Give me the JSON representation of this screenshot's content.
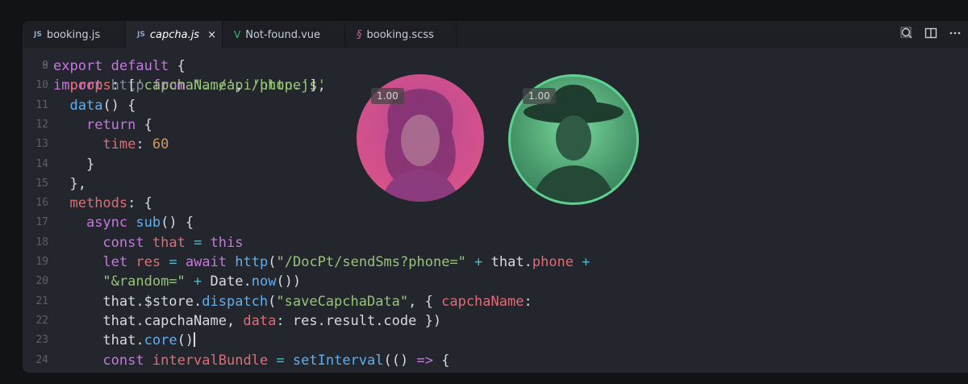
{
  "tabs": [
    {
      "lang": "JS",
      "label": "booking.js",
      "active": false
    },
    {
      "lang": "JS",
      "label": "capcha.js",
      "active": true,
      "close": "×"
    },
    {
      "lang": "V",
      "label": "Not-found.vue",
      "active": false
    },
    {
      "lang": "§",
      "label": "booking.scss",
      "active": false
    }
  ],
  "code_lines": [
    {
      "n": "9",
      "html": "<span class='kw'>export default</span> <span class='plain'>{</span>"
    },
    {
      "n": "10",
      "html": "  <span class='prop'>props</span><span class='plain'>: [</span><span class='str'>'capchaName'</span><span class='plain'>, </span><span class='str'>'phone'</span><span class='plain'>],</span>"
    },
    {
      "n": "11",
      "html": "  <span class='fn'>data</span><span class='plain'>() {</span>"
    },
    {
      "n": "12",
      "html": "    <span class='kw'>return</span> <span class='plain'>{</span>"
    },
    {
      "n": "13",
      "html": "      <span class='prop'>time</span><span class='plain'>: </span><span class='num'>60</span>"
    },
    {
      "n": "14",
      "html": "    <span class='plain'>}</span>"
    },
    {
      "n": "15",
      "html": "  <span class='plain'>},</span>"
    },
    {
      "n": "16",
      "html": "  <span class='prop'>methods</span><span class='plain'>: {</span>"
    },
    {
      "n": "17",
      "html": "    <span class='kw'>async</span> <span class='fn'>sub</span><span class='plain'>() {</span>"
    },
    {
      "n": "18",
      "html": "      <span class='kw'>const</span> <span class='prop'>that</span> <span class='op'>=</span> <span class='kw'>this</span>"
    },
    {
      "n": "19",
      "html": "      <span class='kw'>let</span> <span class='prop'>res</span> <span class='op'>=</span> <span class='kw'>await</span> <span class='fn'>http</span><span class='plain'>(</span><span class='str'>\"/DocPt/sendSms?phone=\"</span> <span class='op'>+</span> <span class='plain'>that.</span><span class='prop'>phone</span> <span class='op'>+</span>"
    },
    {
      "n": "20",
      "html": "      <span class='str'>\"&amp;random=\"</span> <span class='op'>+</span> <span class='plain'>Date.</span><span class='fn'>now</span><span class='plain'>())</span>"
    },
    {
      "n": "21",
      "html": "      <span class='plain'>that.$store.</span><span class='fn'>dispatch</span><span class='plain'>(</span><span class='str'>\"saveCapchaData\"</span><span class='plain'>, { </span><span class='prop'>capchaName</span><span class='plain'>:</span>"
    },
    {
      "n": "22",
      "html": "      <span class='plain'>that.capchaName, </span><span class='prop'>data</span><span class='plain'>: res.result.code })</span>"
    },
    {
      "n": "23",
      "html": "      <span class='plain'>that.</span><span class='fn'>core</span><span class='plain'>()</span><span class='cursor'></span>"
    },
    {
      "n": "24",
      "html": "      <span class='kw'>const</span> <span class='prop'>intervalBundle</span> <span class='op'>=</span> <span class='fn'>setInterval</span><span class='plain'>(() </span><span class='kw'>=&gt;</span> <span class='plain'>{</span>"
    }
  ],
  "overlays": {
    "left_label": "1.00",
    "right_label": "1.00"
  },
  "colors": {
    "left_tint": "#d64f8f",
    "right_tint": "#5fd08e"
  }
}
